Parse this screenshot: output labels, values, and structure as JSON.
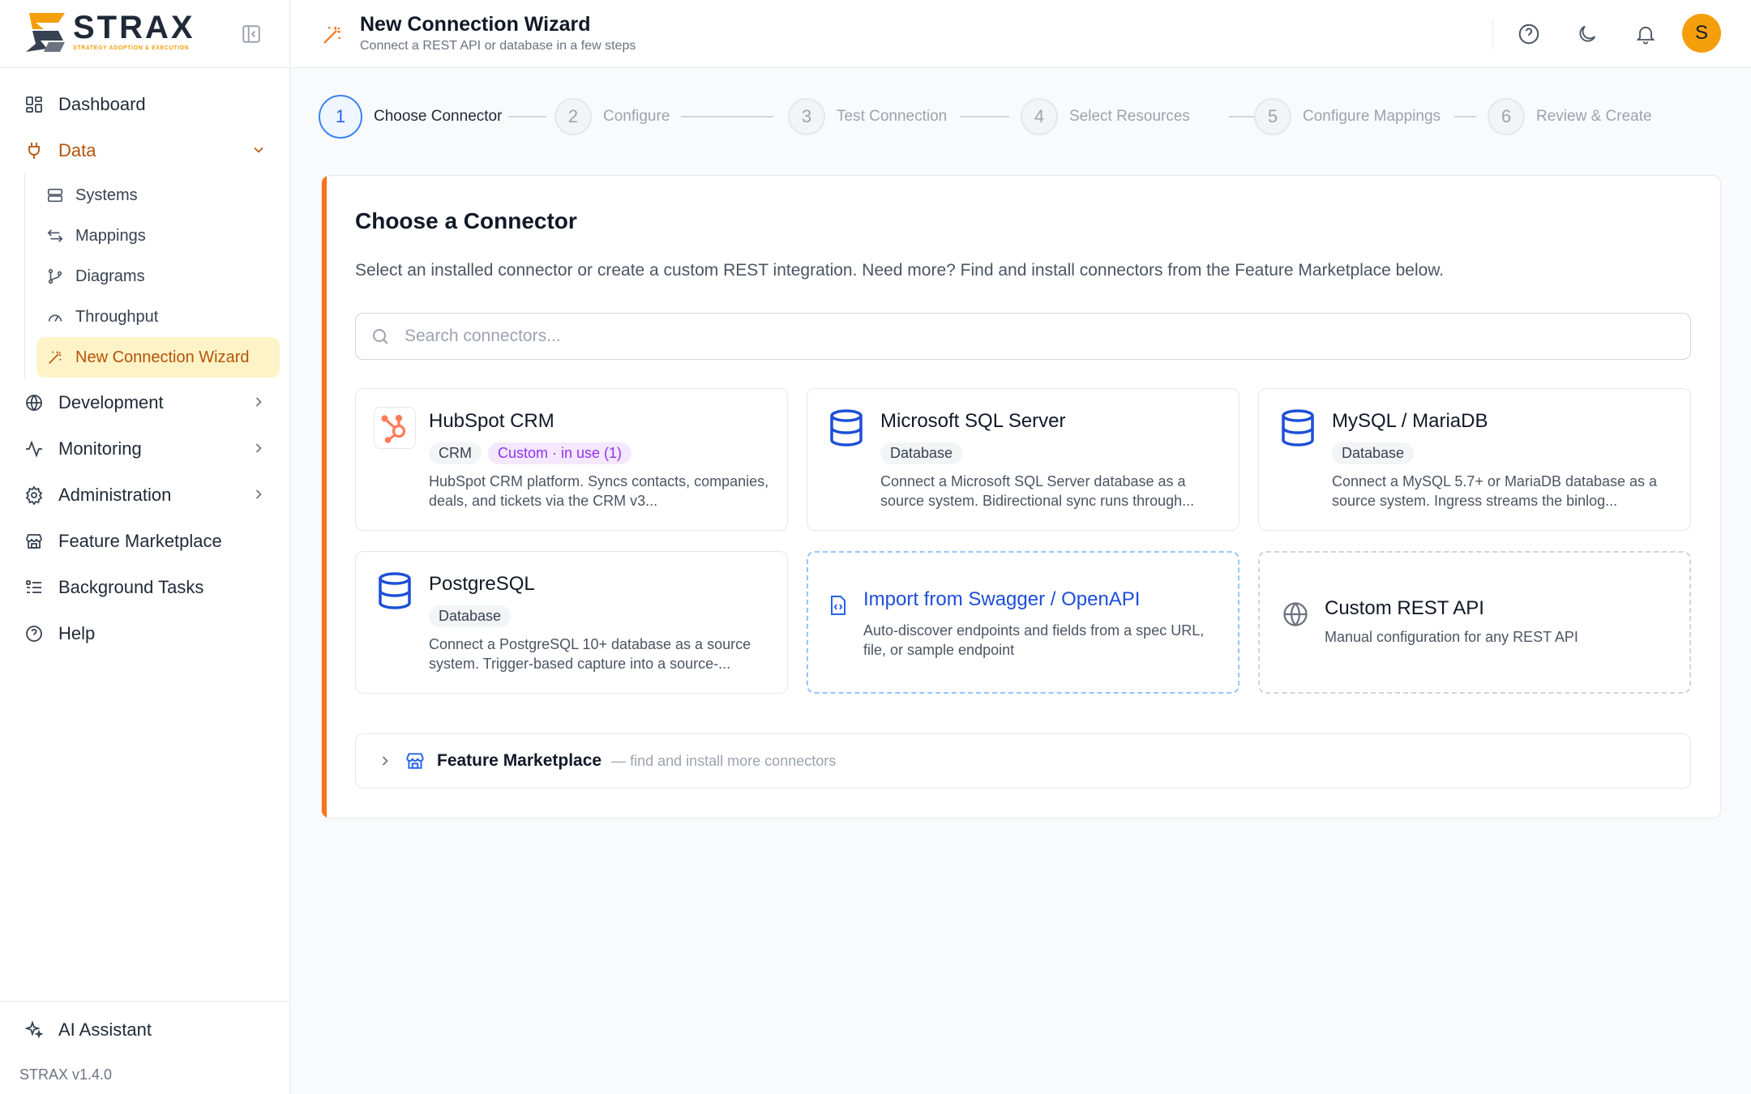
{
  "brand": {
    "name": "STRAX",
    "tagline": "STRATEGY ADOPTION & EXECUTION",
    "version": "STRAX v1.4.0"
  },
  "sidebar": {
    "items": [
      {
        "label": "Dashboard",
        "icon": "dashboard-icon"
      },
      {
        "label": "Data",
        "icon": "plug-icon",
        "expanded": true,
        "children": [
          {
            "label": "Systems",
            "icon": "server-icon"
          },
          {
            "label": "Mappings",
            "icon": "arrows-icon"
          },
          {
            "label": "Diagrams",
            "icon": "git-branch-icon"
          },
          {
            "label": "Throughput",
            "icon": "gauge-icon"
          },
          {
            "label": "New Connection Wizard",
            "icon": "wand-icon",
            "active": true
          }
        ]
      },
      {
        "label": "Development",
        "icon": "globe-icon"
      },
      {
        "label": "Monitoring",
        "icon": "activity-icon"
      },
      {
        "label": "Administration",
        "icon": "gear-icon"
      },
      {
        "label": "Feature Marketplace",
        "icon": "store-icon"
      },
      {
        "label": "Background Tasks",
        "icon": "list-icon"
      },
      {
        "label": "Help",
        "icon": "help-icon"
      }
    ],
    "footer": {
      "ai_label": "AI Assistant"
    }
  },
  "header": {
    "title": "New Connection Wizard",
    "subtitle": "Connect a REST API or database in a few steps",
    "avatar_initial": "S"
  },
  "stepper": {
    "current": 1,
    "steps": [
      {
        "num": "1",
        "label": "Choose Connector"
      },
      {
        "num": "2",
        "label": "Configure"
      },
      {
        "num": "3",
        "label": "Test Connection"
      },
      {
        "num": "4",
        "label": "Select Resources"
      },
      {
        "num": "5",
        "label": "Configure Mappings"
      },
      {
        "num": "6",
        "label": "Review & Create"
      }
    ]
  },
  "panel": {
    "title": "Choose a Connector",
    "description": "Select an installed connector or create a custom REST integration. Need more? Find and install connectors from the Feature Marketplace below.",
    "search_placeholder": "Search connectors...",
    "connectors": [
      {
        "name": "HubSpot CRM",
        "tags": [
          "CRM",
          "Custom · in use (1)"
        ],
        "description": "HubSpot CRM platform. Syncs contacts, companies, deals, and tickets via the CRM v3..."
      },
      {
        "name": "Microsoft SQL Server",
        "tags": [
          "Database"
        ],
        "description": "Connect a Microsoft SQL Server database as a source system. Bidirectional sync runs through..."
      },
      {
        "name": "MySQL / MariaDB",
        "tags": [
          "Database"
        ],
        "description": "Connect a MySQL 5.7+ or MariaDB database as a source system. Ingress streams the binlog..."
      },
      {
        "name": "PostgreSQL",
        "tags": [
          "Database"
        ],
        "description": "Connect a PostgreSQL 10+ database as a source system. Trigger-based capture into a source-..."
      }
    ],
    "swagger": {
      "title": "Import from Swagger / OpenAPI",
      "description": "Auto-discover endpoints and fields from a spec URL, file, or sample endpoint"
    },
    "custom": {
      "title": "Custom REST API",
      "description": "Manual configuration for any REST API"
    },
    "marketplace": {
      "title": "Feature Marketplace",
      "subtitle": "— find and install more connectors"
    }
  },
  "colors": {
    "accent": "#f59e0b",
    "primary": "#2563eb",
    "panel_accent": "#f97316",
    "hubspot": "#ff7a59"
  }
}
